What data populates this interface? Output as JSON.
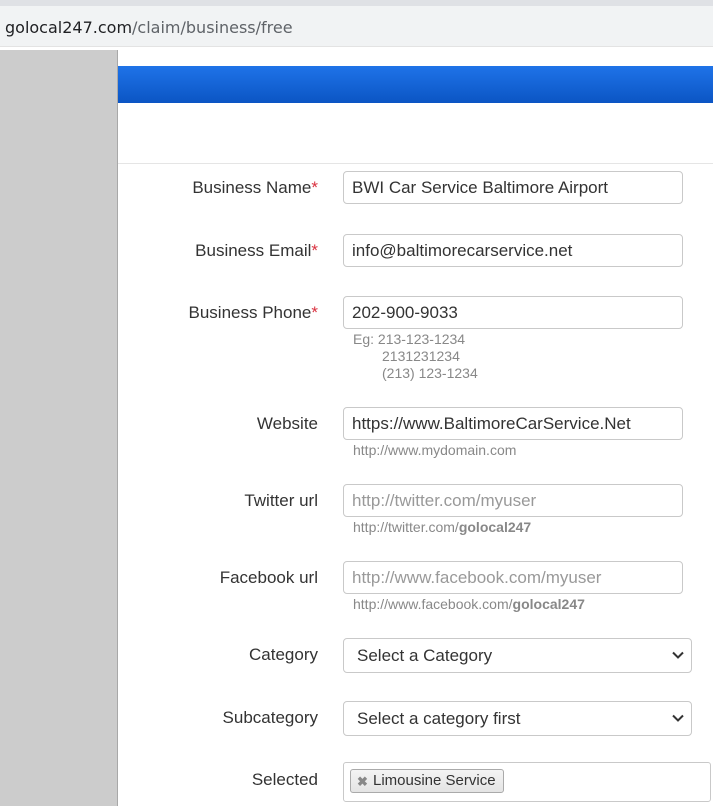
{
  "browser": {
    "url_domain": "golocal247.com",
    "url_path": "/claim/business/free"
  },
  "form": {
    "business_name": {
      "label": "Business Name",
      "required_mark": "*",
      "value": "BWI Car Service Baltimore Airport"
    },
    "business_email": {
      "label": "Business Email",
      "required_mark": "*",
      "value": "info@baltimorecarservice.net"
    },
    "business_phone": {
      "label": "Business Phone",
      "required_mark": "*",
      "value": "202-900-9033",
      "help_lines": [
        "Eg: 213-123-1234",
        "2131231234",
        "(213) 123-1234"
      ]
    },
    "website": {
      "label": "Website",
      "value": "https://www.BaltimoreCarService.Net",
      "help": "http://www.mydomain.com"
    },
    "twitter": {
      "label": "Twitter url",
      "placeholder": "http://twitter.com/myuser",
      "help_prefix": "http://twitter.com/",
      "help_bold": "golocal247"
    },
    "facebook": {
      "label": "Facebook url",
      "placeholder": "http://www.facebook.com/myuser",
      "help_prefix": "http://www.facebook.com/",
      "help_bold": "golocal247"
    },
    "category": {
      "label": "Category",
      "selected": "Select a Category"
    },
    "subcategory": {
      "label": "Subcategory",
      "selected": "Select a category first"
    },
    "selected": {
      "label": "Selected",
      "tags": [
        "Limousine Service"
      ]
    }
  },
  "colors": {
    "header_blue": "#1f73e8",
    "required_red": "#d9303e"
  }
}
